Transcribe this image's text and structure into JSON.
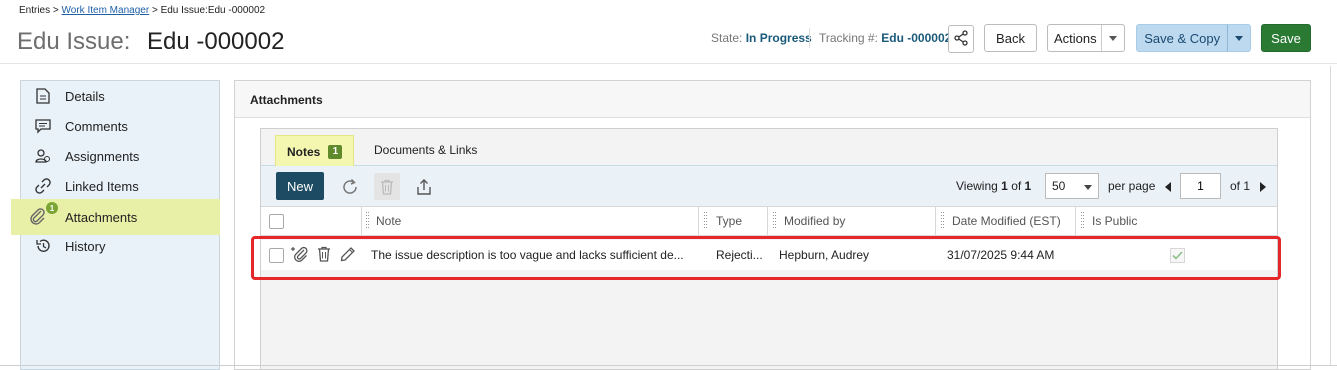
{
  "breadcrumb": {
    "root": "Entries",
    "sep1": ">",
    "link": "Work Item Manager",
    "sep2": ">",
    "current": "Edu Issue:Edu -000002"
  },
  "header": {
    "title_prefix": "Edu Issue:",
    "title_id": "Edu -000002",
    "state_label": "State:",
    "state_value": "In Progress",
    "tracking_label": "Tracking #:",
    "tracking_value": "Edu -000002",
    "back_label": "Back",
    "actions_label": "Actions",
    "save_copy_label": "Save & Copy",
    "save_label": "Save"
  },
  "sidebar": {
    "items": [
      {
        "label": "Details",
        "icon": "document-icon"
      },
      {
        "label": "Comments",
        "icon": "comment-icon"
      },
      {
        "label": "Assignments",
        "icon": "assignment-icon"
      },
      {
        "label": "Linked Items",
        "icon": "link-icon"
      },
      {
        "label": "Attachments",
        "icon": "paperclip-icon",
        "badge": "1",
        "active": true
      },
      {
        "label": "History",
        "icon": "history-icon"
      }
    ]
  },
  "panel": {
    "title": "Attachments",
    "tabs": [
      {
        "label": "Notes",
        "count": "1",
        "active": true
      },
      {
        "label": "Documents & Links"
      }
    ],
    "toolbar": {
      "new_label": "New",
      "viewing_label": "Viewing",
      "viewing_from": "1",
      "viewing_of": "of",
      "viewing_total": "1",
      "per_page_value": "50",
      "per_page_label": "per page",
      "page_value": "1",
      "of_pages": "of 1"
    },
    "columns": [
      "Note",
      "Type",
      "Modified by",
      "Date Modified (EST)",
      "Is Public"
    ],
    "rows": [
      {
        "note": "The issue description is too vague and lacks sufficient de...",
        "type": "Rejecti...",
        "modified_by": "Hepburn, Audrey",
        "date_modified": "31/07/2025 9:44 AM",
        "is_public": true
      }
    ]
  },
  "colors": {
    "accent": "#1d4b63",
    "save_green": "#2b7a34",
    "save_copy_blue": "#bcd9ef",
    "highlight_yellow": "#e8efa6",
    "selection_red": "#e5262a"
  }
}
